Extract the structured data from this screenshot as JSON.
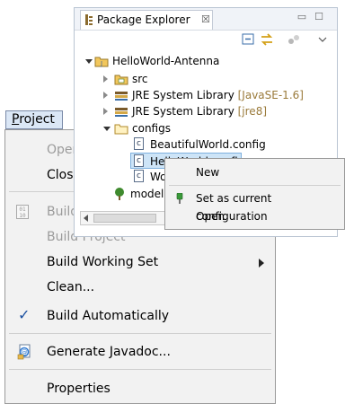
{
  "project_menu": {
    "title_prefix": "P",
    "title_rest": "roject",
    "items": [
      {
        "label": "Open Project",
        "enabled": false
      },
      {
        "label": "Close Project",
        "enabled": true
      },
      {
        "label": "Build All",
        "enabled": false,
        "icon": "build-binary-icon"
      },
      {
        "label": "Build Project",
        "enabled": false
      },
      {
        "label": "Build Working Set",
        "enabled": true,
        "submenu": true
      },
      {
        "label": "Clean...",
        "enabled": true
      },
      {
        "label": "Build Automatically",
        "enabled": true,
        "checked": true
      },
      {
        "label": "Generate Javadoc...",
        "enabled": true,
        "icon": "javadoc-icon"
      },
      {
        "label": "Properties",
        "enabled": true
      }
    ]
  },
  "package_explorer": {
    "tab_title": "Package Explorer",
    "tab_close": "☒",
    "tree": [
      {
        "label": "HelloWorld-Antenna",
        "decoration": "",
        "level": 0,
        "expanded": true,
        "icon": "project-icon"
      },
      {
        "label": "src",
        "decoration": "",
        "level": 1,
        "expanded": false,
        "icon": "source-folder-icon"
      },
      {
        "label": "JRE System Library",
        "decoration": "[JavaSE-1.6]",
        "level": 1,
        "expanded": false,
        "icon": "library-icon"
      },
      {
        "label": "JRE System Library",
        "decoration": "[jre8]",
        "level": 1,
        "expanded": false,
        "icon": "library-icon"
      },
      {
        "label": "configs",
        "decoration": "",
        "level": 1,
        "expanded": true,
        "icon": "folder-icon"
      },
      {
        "label": "BeautifulWorld.config",
        "decoration": "",
        "level": 2,
        "icon": "config-file-icon"
      },
      {
        "label": "HelloWorld.config",
        "decoration": "",
        "level": 2,
        "icon": "config-file-icon",
        "selected": true
      },
      {
        "label": "Wo",
        "decoration": "",
        "level": 2,
        "icon": "config-file-icon"
      },
      {
        "label": "model",
        "decoration": "",
        "level": 1,
        "icon": "model-tree-icon"
      }
    ]
  },
  "context_menu": {
    "items": [
      {
        "label": "New"
      },
      {
        "label": "Set as current configuration",
        "icon": "pin-icon"
      },
      {
        "label": "Open"
      }
    ]
  },
  "colors": {
    "menu_bg": "#f2f2f2",
    "disabled_text": "#9b9b9b",
    "selection_bg": "#cde4f7",
    "decoration_text": "#9a7a3a",
    "check_color": "#1a4fa0"
  }
}
